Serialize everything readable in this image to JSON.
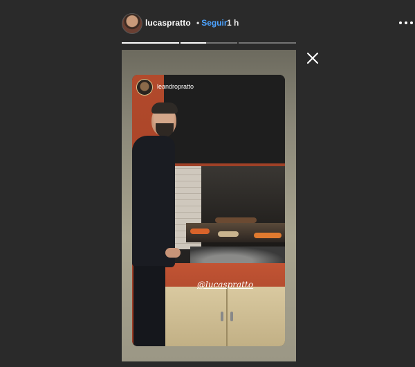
{
  "header": {
    "username": "lucaspratto",
    "separator": "•",
    "follow_label": "Seguir",
    "time": "1 h",
    "avatar_icon": "profile-avatar"
  },
  "progress": {
    "segments": [
      {
        "state": "viewed",
        "fill": 1.0
      },
      {
        "state": "current",
        "fill": 0.45
      },
      {
        "state": "upcoming",
        "fill": 0.0
      }
    ]
  },
  "story": {
    "repost": {
      "username": "leandropratto",
      "mention": "@lucaspratto"
    }
  },
  "icons": {
    "close": "close-icon",
    "more": "more-options-icon"
  }
}
